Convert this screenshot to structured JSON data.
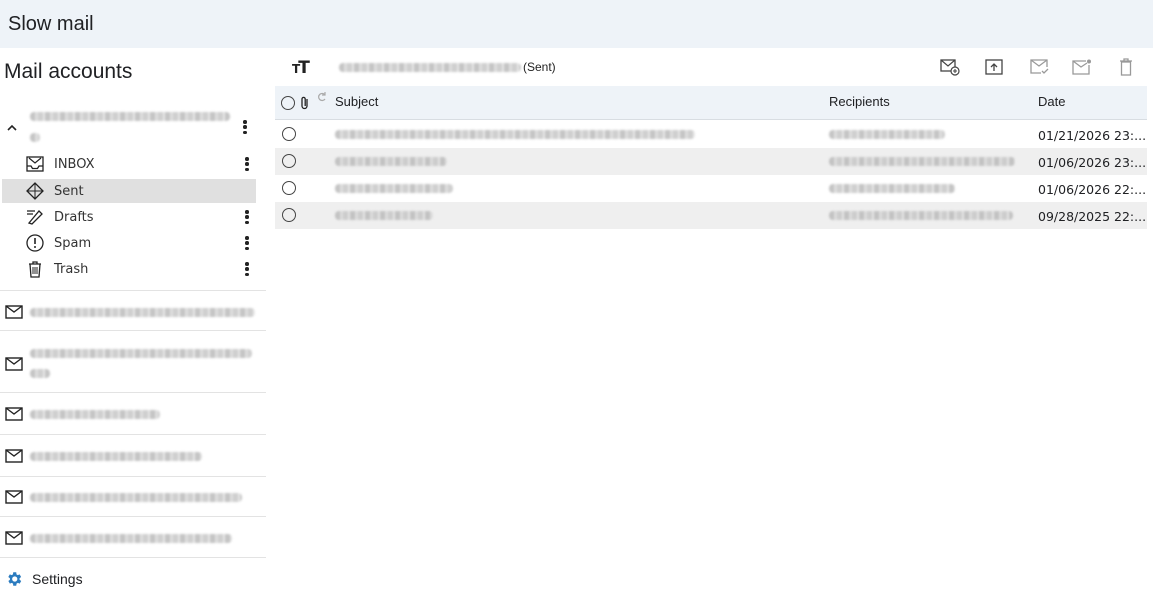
{
  "app": {
    "title": "Slow mail"
  },
  "sidebar": {
    "title": "Mail accounts",
    "folders": [
      {
        "label": "INBOX",
        "icon": "inbox-icon"
      },
      {
        "label": "Sent",
        "icon": "sent-icon",
        "active": true
      },
      {
        "label": "Drafts",
        "icon": "drafts-icon"
      },
      {
        "label": "Spam",
        "icon": "spam-icon"
      },
      {
        "label": "Trash",
        "icon": "trash-icon"
      }
    ],
    "settings_label": "Settings"
  },
  "main": {
    "folder_suffix": "(Sent)",
    "columns": {
      "subject": "Subject",
      "recipients": "Recipients",
      "date": "Date"
    },
    "rows": [
      {
        "date": "01/21/2026 23:..."
      },
      {
        "date": "01/06/2026 23:..."
      },
      {
        "date": "01/06/2026 22:..."
      },
      {
        "date": "09/28/2025 22:..."
      }
    ]
  },
  "colors": {
    "header_bg": "#eef3f8",
    "active_folder_bg": "#e0e0e0",
    "settings_icon": "#2b7bbf"
  }
}
